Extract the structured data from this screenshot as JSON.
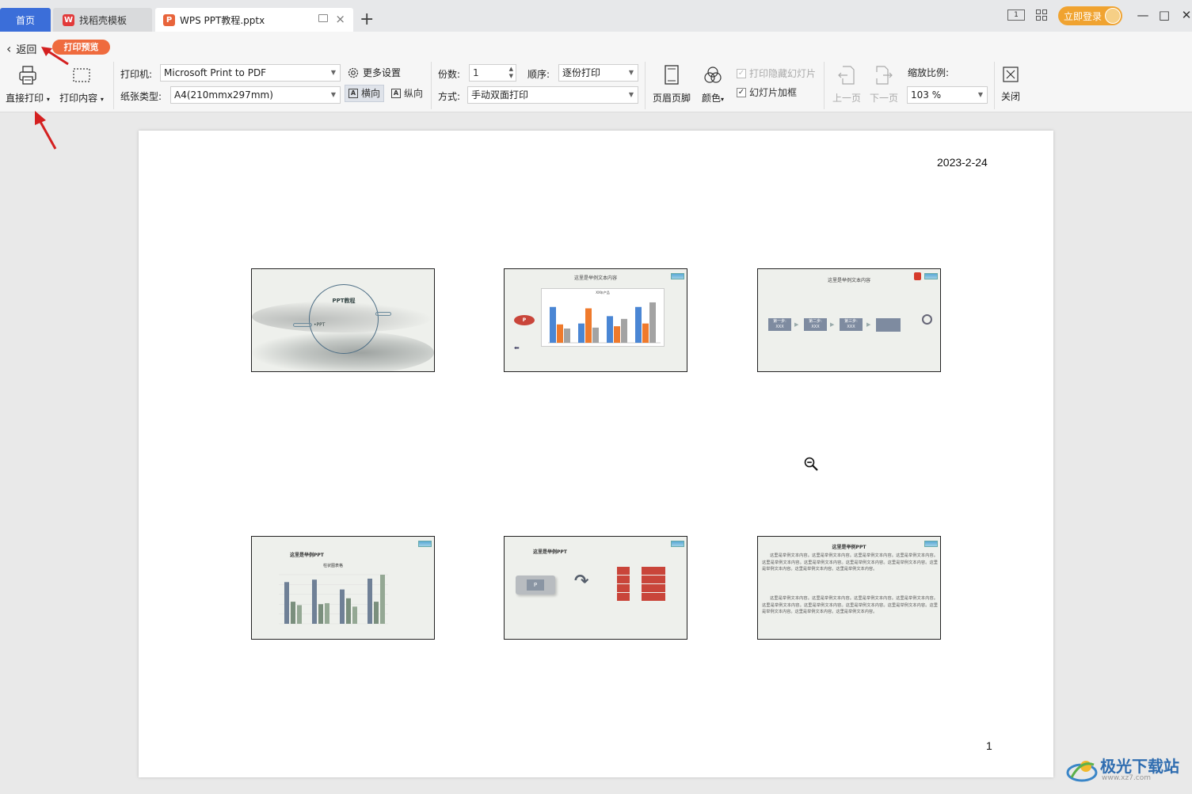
{
  "tabs": {
    "home": "首页",
    "template": "找稻壳模板",
    "document": "WPS PPT教程.pptx",
    "document_icon": "P"
  },
  "title_bar": {
    "login": "立即登录",
    "reading_mode_icon": "1"
  },
  "toolbar": {
    "back": "返回",
    "mode_badge": "打印预览",
    "direct_print": "直接打印",
    "print_content": "打印内容",
    "printer_label": "打印机:",
    "printer_value": "Microsoft Print to PDF",
    "paper_label": "纸张类型:",
    "paper_value": "A4(210mmx297mm)",
    "more_settings": "更多设置",
    "landscape": "横向",
    "portrait": "纵向",
    "copies_label": "份数:",
    "copies_value": "1",
    "order_label": "顺序:",
    "order_value": "逐份打印",
    "method_label": "方式:",
    "method_value": "手动双面打印",
    "header_footer": "页眉页脚",
    "color": "颜色",
    "print_hidden": "打印隐藏幻灯片",
    "slide_frame": "幻灯片加框",
    "prev_page": "上一页",
    "next_page": "下一页",
    "zoom_label": "缩放比例:",
    "zoom_value": "103 %",
    "close": "关闭"
  },
  "page": {
    "date": "2023-2-24",
    "page_number": "1"
  },
  "slides": {
    "s1_title": "PPT教程",
    "s1_sub": "•PPT",
    "s2_title": "这里是举例文本内容",
    "s2_chart_title": "XX年产品",
    "s3_title": "这里是举例文本内容",
    "s3_steps": [
      "第一步:",
      "第二步:",
      "第三步:"
    ],
    "s3_step_sub": "XXX",
    "s4_title": "这里是举例PPT",
    "s4_chart_title": "柱状图表格",
    "s5_title": "这里是举例PPT",
    "s6_title": "这里是举例PPT",
    "s6_para1": "这里是举例文本内容。这里是举例文本内容。这里是举例文本内容。这里是举例文本内容。这里是举例文本内容。这里是举例文本内容。这里是举例文本内容。这里是举例文本内容。这里是举例文本内容。这里是举例文本内容。这里是举例文本内容。",
    "s6_para2": "这里是举例文本内容。这里是举例文本内容。这里是举例文本内容。这里是举例文本内容。这里是举例文本内容。这里是举例文本内容。这里是举例文本内容。这里是举例文本内容。这里是举例文本内容。这里是举例文本内容。这里是举例文本内容。"
  },
  "colors": {
    "accent_blue": "#3b6ed9",
    "badge_orange": "#ef6b3e",
    "login_orange": "#f0a330",
    "arrow_red": "#d42020",
    "chart_blue": "#4a86d4",
    "chart_orange": "#ef7a2c",
    "chart_gray": "#a3a3a3",
    "chart_green": "#7a8f7d"
  },
  "watermark": "极光下载站"
}
